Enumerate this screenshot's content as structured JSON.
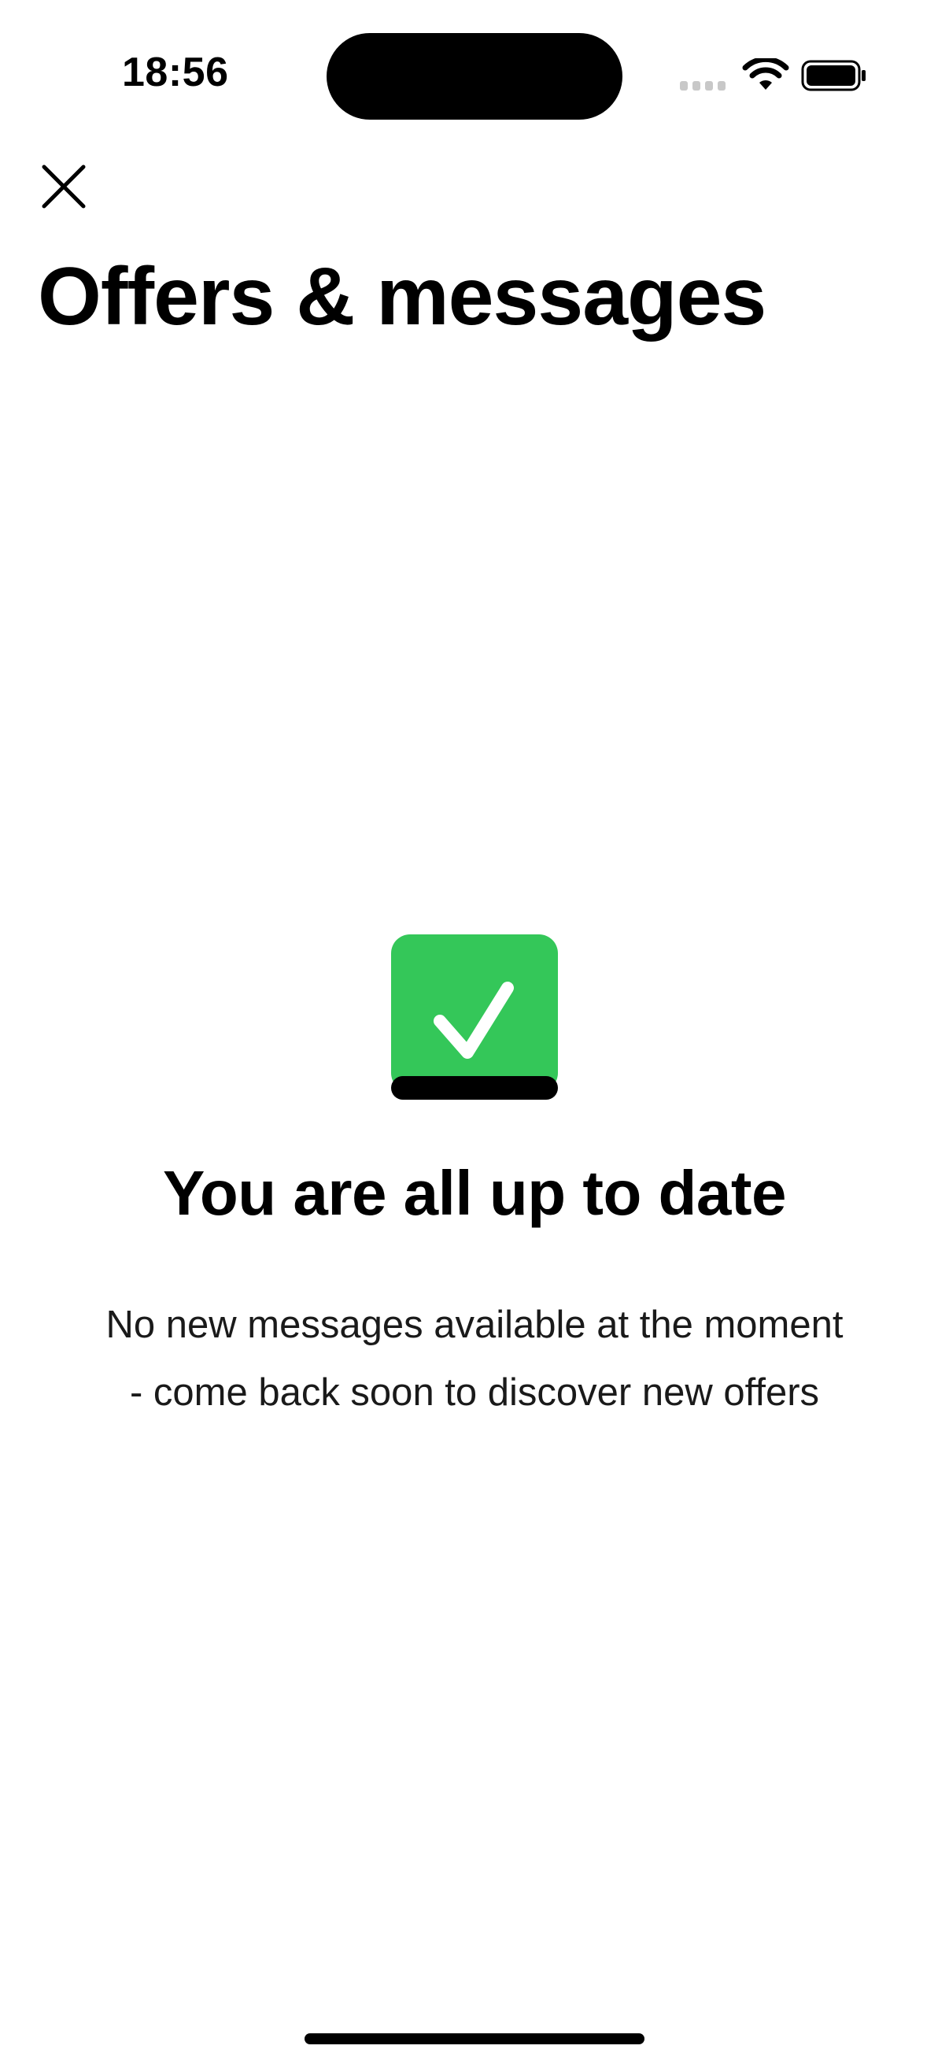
{
  "status_bar": {
    "time": "18:56",
    "icons": [
      "signal-icon",
      "wifi-icon",
      "battery-icon"
    ]
  },
  "header": {
    "close_icon": "close-icon",
    "title": "Offers & messages"
  },
  "empty_state": {
    "icon": "green-checkbox-icon",
    "title": "You are all up to date",
    "line1": "No new messages available at the moment",
    "line2": "- come back soon to discover new offers"
  },
  "colors": {
    "accent_green": "#34C759",
    "text": "#000000",
    "background": "#FFFFFF"
  }
}
